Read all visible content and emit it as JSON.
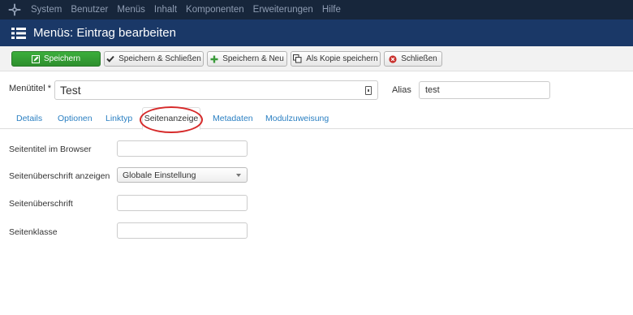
{
  "topnav": {
    "items": [
      "System",
      "Benutzer",
      "Menüs",
      "Inhalt",
      "Komponenten",
      "Erweiterungen",
      "Hilfe"
    ]
  },
  "header": {
    "title": "Menüs: Eintrag bearbeiten"
  },
  "toolbar": {
    "save_label": "Speichern",
    "save_close_label": "Speichern & Schließen",
    "save_new_label": "Speichern & Neu",
    "save_copy_label": "Als Kopie speichern",
    "close_label": "Schließen"
  },
  "item": {
    "menutitle_label": "Menütitel *",
    "menutitle_value": "Test",
    "alias_label": "Alias",
    "alias_value": "test"
  },
  "tabs": [
    "Details",
    "Optionen",
    "Linktyp",
    "Seitenanzeige",
    "Metadaten",
    "Modulzuweisung"
  ],
  "active_tab": "Seitenanzeige",
  "form": {
    "browser_title_label": "Seitentitel im Browser",
    "browser_title_value": "",
    "show_heading_label": "Seitenüberschrift anzeigen",
    "show_heading_value": "Globale Einstellung",
    "heading_label": "Seitenüberschrift",
    "heading_value": "",
    "page_class_label": "Seitenklasse",
    "page_class_value": ""
  },
  "colors": {
    "topnav_bg": "#17263b",
    "header_bg": "#1a3867",
    "save_green": "#2e8f2e",
    "link_blue": "#2a7fc2",
    "highlight_red": "#d62a2a"
  }
}
